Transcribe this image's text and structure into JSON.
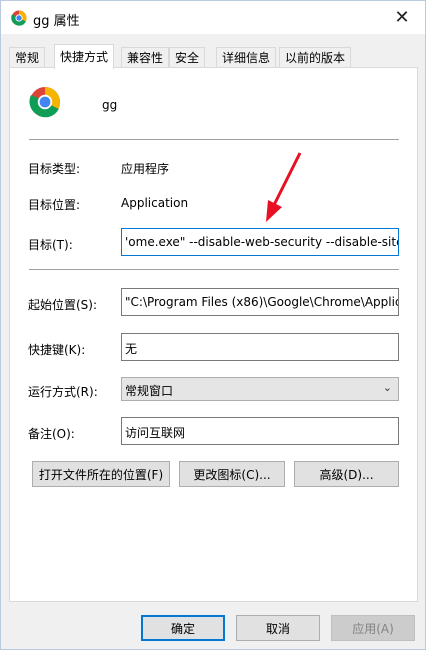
{
  "window": {
    "title": "gg 属性",
    "close_glyph": "✕"
  },
  "tabs": [
    {
      "label": "常规"
    },
    {
      "label": "快捷方式"
    },
    {
      "label": "兼容性"
    },
    {
      "label": "安全"
    },
    {
      "label": "详细信息"
    },
    {
      "label": "以前的版本"
    }
  ],
  "active_tab": "快捷方式",
  "shortcut": {
    "name": "gg",
    "target_type_label": "目标类型:",
    "target_type_value": "应用程序",
    "target_location_label": "目标位置:",
    "target_location_value": "Application",
    "target_label": "目标(T):",
    "target_value": "'ome.exe\" --disable-web-security --disable-site-",
    "start_in_label": "起始位置(S):",
    "start_in_value": "\"C:\\Program Files (x86)\\Google\\Chrome\\Applic",
    "hotkey_label": "快捷键(K):",
    "hotkey_value": "无",
    "run_label": "运行方式(R):",
    "run_value": "常规窗口",
    "comment_label": "备注(O):",
    "comment_value": "访问互联网",
    "open_location_button": "打开文件所在的位置(F)",
    "change_icon_button": "更改图标(C)...",
    "advanced_button": "高级(D)..."
  },
  "footer": {
    "ok": "确定",
    "cancel": "取消",
    "apply": "应用(A)"
  },
  "colors": {
    "accent": "#0078d7",
    "annotation_arrow": "#e81123"
  }
}
